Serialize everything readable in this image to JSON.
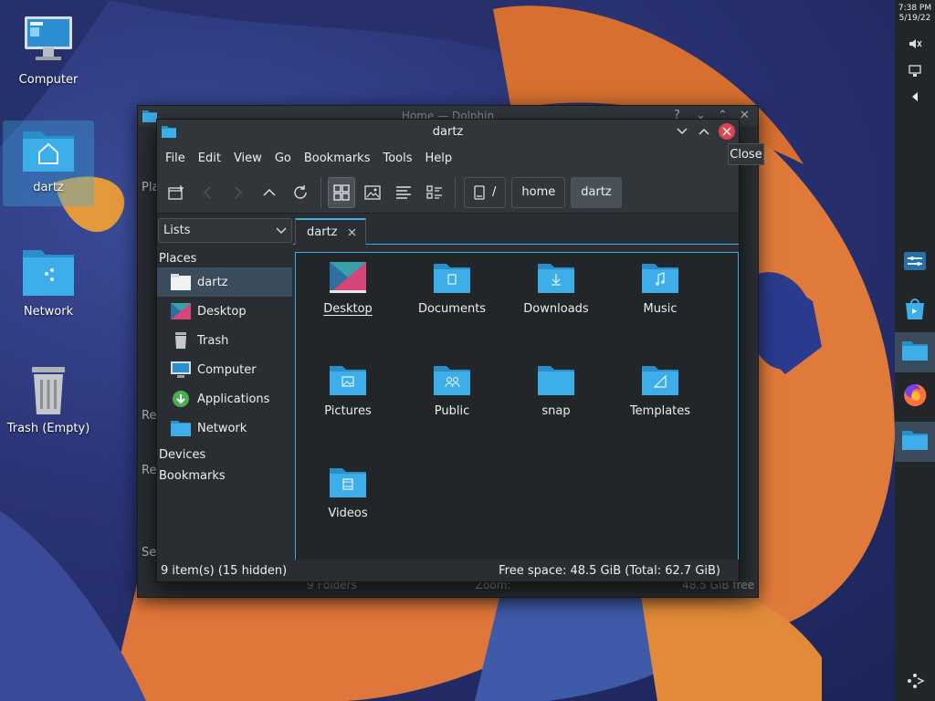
{
  "desktop": {
    "icons": [
      {
        "label": "Computer"
      },
      {
        "label": "dartz"
      },
      {
        "label": "Network"
      },
      {
        "label": "Trash (Empty)"
      }
    ]
  },
  "panel": {
    "time": "7:38 PM",
    "date": "5/19/22"
  },
  "back_window": {
    "title": "Home — Dolphin",
    "side_labels": [
      "Pla",
      "Re",
      "Re",
      "Se"
    ],
    "status_left": "9 Folders",
    "status_zoom": "Zoom:",
    "status_right": "48.5 GiB free"
  },
  "window": {
    "title": "dartz",
    "close_tooltip": "Close",
    "menu": [
      "File",
      "Edit",
      "View",
      "Go",
      "Bookmarks",
      "Tools",
      "Help"
    ],
    "breadcrumb": [
      "/",
      "home",
      "dartz"
    ],
    "panel_mode": "Lists",
    "places_header": "Places",
    "places": [
      {
        "label": "dartz",
        "selected": true
      },
      {
        "label": "Desktop"
      },
      {
        "label": "Trash"
      },
      {
        "label": "Computer"
      },
      {
        "label": "Applications"
      },
      {
        "label": "Network"
      }
    ],
    "devices_header": "Devices",
    "bookmarks_header": "Bookmarks",
    "tab_label": "dartz",
    "items": [
      {
        "label": "Desktop",
        "icon": "desktop-folder-icon"
      },
      {
        "label": "Documents",
        "icon": "documents-folder-icon"
      },
      {
        "label": "Downloads",
        "icon": "downloads-folder-icon"
      },
      {
        "label": "Music",
        "icon": "music-folder-icon"
      },
      {
        "label": "Pictures",
        "icon": "pictures-folder-icon"
      },
      {
        "label": "Public",
        "icon": "public-folder-icon"
      },
      {
        "label": "snap",
        "icon": "folder-icon"
      },
      {
        "label": "Templates",
        "icon": "templates-folder-icon"
      },
      {
        "label": "Videos",
        "icon": "videos-folder-icon"
      }
    ],
    "status_left": "9 item(s) (15 hidden)",
    "status_right": "Free space: 48.5 GiB (Total: 62.7 GiB)"
  },
  "colors": {
    "accent": "#3daee9",
    "folder": "#3daee9",
    "close": "#da4453"
  }
}
